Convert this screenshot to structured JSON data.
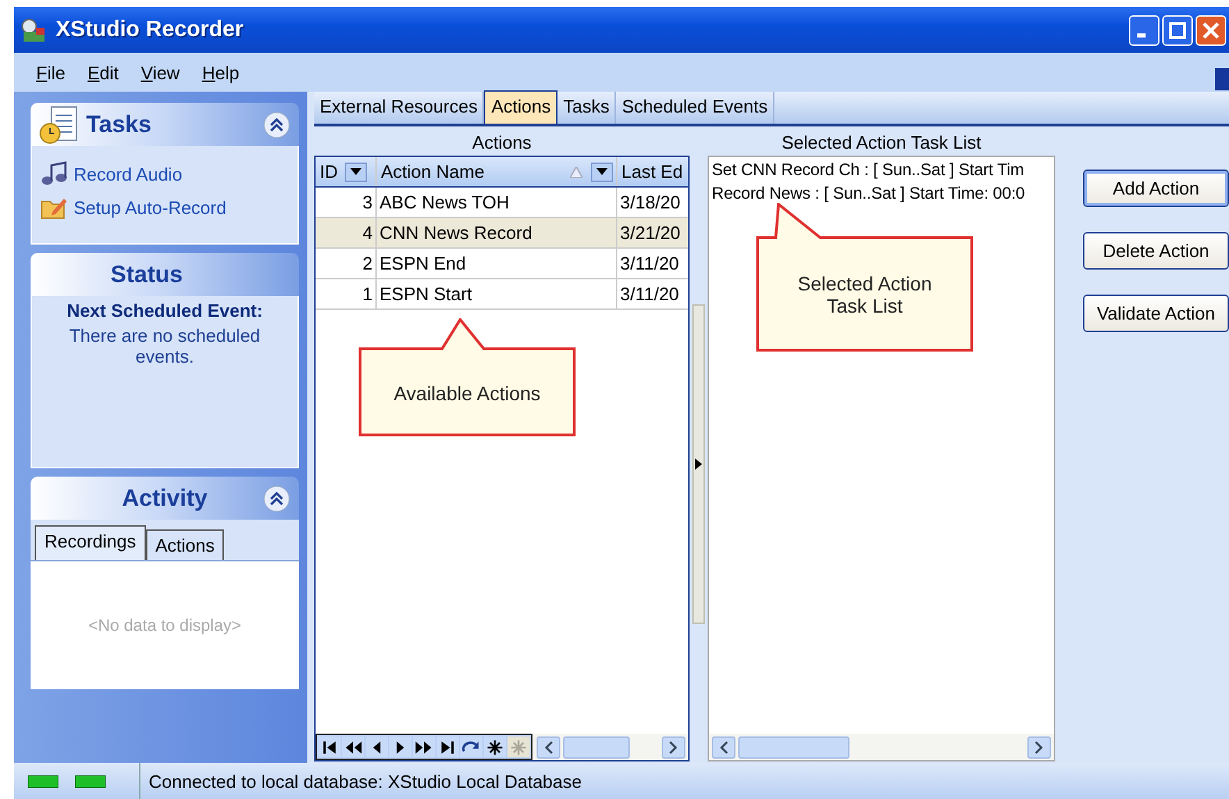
{
  "window": {
    "title": "XStudio Recorder"
  },
  "menu": [
    {
      "label": "File"
    },
    {
      "label": "Edit"
    },
    {
      "label": "View"
    },
    {
      "label": "Help"
    }
  ],
  "sidebar": {
    "tasks": {
      "title": "Tasks",
      "items": [
        {
          "label": "Record Audio",
          "kind": "audio"
        },
        {
          "label": "Setup Auto-Record",
          "kind": "setup"
        }
      ]
    },
    "status": {
      "title": "Status",
      "heading": "Next Scheduled Event:",
      "message": "There are no scheduled events."
    },
    "activity": {
      "title": "Activity",
      "tabs": [
        {
          "label": "Recordings",
          "selected": true
        },
        {
          "label": "Actions",
          "selected": false
        }
      ],
      "empty": "<No data to display>"
    }
  },
  "tabs": [
    {
      "label": "External Resources",
      "selected": false
    },
    {
      "label": "Actions",
      "selected": true
    },
    {
      "label": "Tasks",
      "selected": false
    },
    {
      "label": "Scheduled Events",
      "selected": false
    }
  ],
  "actions": {
    "caption": "Actions",
    "columns": [
      "ID",
      "Action Name",
      "Last Ed"
    ],
    "rows": [
      {
        "id": "3",
        "name": "ABC News TOH",
        "last_edited": "3/18/20",
        "selected": false
      },
      {
        "id": "4",
        "name": "CNN News Record",
        "last_edited": "3/21/20",
        "selected": true
      },
      {
        "id": "2",
        "name": "ESPN End",
        "last_edited": "3/11/20",
        "selected": false
      },
      {
        "id": "1",
        "name": "ESPN Start",
        "last_edited": "3/11/20",
        "selected": false
      }
    ]
  },
  "task_list": {
    "caption": "Selected Action Task List",
    "lines": [
      "Set CNN Record Ch : [ Sun..Sat ] Start Tim",
      "Record News : [ Sun..Sat ] Start Time: 00:0"
    ]
  },
  "buttons": [
    {
      "label": "Add Action",
      "selected": true
    },
    {
      "label": "Delete Action",
      "selected": false
    },
    {
      "label": "Validate Action",
      "selected": false
    }
  ],
  "callouts": [
    {
      "text": "Available Actions"
    },
    {
      "text": "Selected Action Task List"
    }
  ],
  "status_bar": {
    "text": "Connected to local database: XStudio Local Database"
  }
}
